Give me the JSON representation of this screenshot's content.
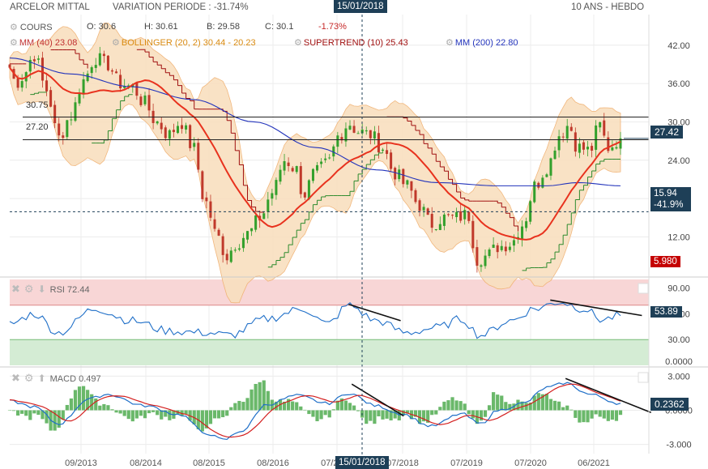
{
  "header": {
    "instrument": "ARCELOR MITTAL",
    "variation": "VARIATION PERIODE : -31.74%",
    "cursor_date": "15/01/2018",
    "period": "10 ANS - HEBDO"
  },
  "price_legend": {
    "cours": "COURS",
    "open": "O: 30.6",
    "high": "H: 30.61",
    "low": "B: 29.58",
    "close": "C: 30.1",
    "change": "-1.73%",
    "mm40": "MM (40)",
    "mm40_value": "23.08",
    "bollinger": "BOLLINGER (20, 2)",
    "bollinger_value": "30.44 - 20.23",
    "supertrend": "SUPERTREND (10)",
    "supertrend_value": "25.43",
    "mm200": "MM (200)",
    "mm200_value": "22.80"
  },
  "rsi_legend": {
    "name": "RSI",
    "value": "72.44"
  },
  "macd_legend": {
    "name": "MACD",
    "value": "0.497"
  },
  "colors": {
    "candle_up": "#33a02c",
    "candle_down": "#c0392b",
    "mm40": "#e8321e",
    "bollinger_fill": "#f9dfbf",
    "bollinger_line": "#f0b070",
    "supertrend_up": "#2e8b2e",
    "supertrend_down": "#a01010",
    "mm200": "#2233bb",
    "rsi_line": "#1f6fc8",
    "rsi_high_zone": "#f8d6d6",
    "rsi_low_zone": "#d4ecd4",
    "macd_line": "#1f6fc8",
    "macd_signal": "#d42020",
    "macd_hist": "#6ab86a",
    "current_box": "#1e3f57",
    "low_box": "#c40000"
  },
  "chart_data": [
    {
      "type": "candlestick",
      "title": "ARCELOR MITTAL",
      "ylim": [
        5.98,
        44
      ],
      "y_ticks": [
        "42.00",
        "36.00",
        "30.00",
        "24.00",
        "18.00",
        "12.00"
      ],
      "x_ticks": [
        "09/2013",
        "08/2014",
        "08/2015",
        "08/2016",
        "07/2017",
        "07/2018",
        "07/2019",
        "07/2020",
        "06/2021"
      ],
      "last_price": "27.42",
      "reference_line": "15.94",
      "reference_change": "-41.9%",
      "low_marker": "5.980",
      "horizontal_levels": [
        {
          "label": "30.75",
          "value": 30.75
        },
        {
          "label": "27.20",
          "value": 27.2
        }
      ],
      "close_anchors": [
        {
          "x": 0.0,
          "y": 38.5
        },
        {
          "x": 0.01,
          "y": 36.0
        },
        {
          "x": 0.02,
          "y": 37.0
        },
        {
          "x": 0.04,
          "y": 40.5
        },
        {
          "x": 0.06,
          "y": 35.0
        },
        {
          "x": 0.08,
          "y": 27.5
        },
        {
          "x": 0.1,
          "y": 31.0
        },
        {
          "x": 0.12,
          "y": 36.5
        },
        {
          "x": 0.14,
          "y": 40.0
        },
        {
          "x": 0.16,
          "y": 39.0
        },
        {
          "x": 0.18,
          "y": 36.0
        },
        {
          "x": 0.2,
          "y": 35.5
        },
        {
          "x": 0.22,
          "y": 33.0
        },
        {
          "x": 0.24,
          "y": 30.0
        },
        {
          "x": 0.26,
          "y": 28.0
        },
        {
          "x": 0.28,
          "y": 30.0
        },
        {
          "x": 0.3,
          "y": 26.0
        },
        {
          "x": 0.32,
          "y": 17.5
        },
        {
          "x": 0.34,
          "y": 12.0
        },
        {
          "x": 0.355,
          "y": 9.0
        },
        {
          "x": 0.37,
          "y": 11.0
        },
        {
          "x": 0.39,
          "y": 12.5
        },
        {
          "x": 0.41,
          "y": 15.0
        },
        {
          "x": 0.43,
          "y": 19.0
        },
        {
          "x": 0.45,
          "y": 24.0
        },
        {
          "x": 0.47,
          "y": 22.5
        },
        {
          "x": 0.48,
          "y": 18.5
        },
        {
          "x": 0.5,
          "y": 22.0
        },
        {
          "x": 0.52,
          "y": 23.5
        },
        {
          "x": 0.54,
          "y": 28.0
        },
        {
          "x": 0.555,
          "y": 29.8
        },
        {
          "x": 0.57,
          "y": 28.5
        },
        {
          "x": 0.59,
          "y": 28.0
        },
        {
          "x": 0.61,
          "y": 26.0
        },
        {
          "x": 0.63,
          "y": 22.0
        },
        {
          "x": 0.65,
          "y": 20.0
        },
        {
          "x": 0.67,
          "y": 17.0
        },
        {
          "x": 0.69,
          "y": 14.0
        },
        {
          "x": 0.71,
          "y": 15.0
        },
        {
          "x": 0.73,
          "y": 15.0
        },
        {
          "x": 0.75,
          "y": 15.5
        },
        {
          "x": 0.765,
          "y": 8.5
        },
        {
          "x": 0.78,
          "y": 9.0
        },
        {
          "x": 0.8,
          "y": 10.5
        },
        {
          "x": 0.82,
          "y": 11.0
        },
        {
          "x": 0.84,
          "y": 14.0
        },
        {
          "x": 0.86,
          "y": 20.0
        },
        {
          "x": 0.88,
          "y": 23.0
        },
        {
          "x": 0.9,
          "y": 28.0
        },
        {
          "x": 0.915,
          "y": 29.5
        },
        {
          "x": 0.93,
          "y": 26.0
        },
        {
          "x": 0.95,
          "y": 25.5
        },
        {
          "x": 0.965,
          "y": 29.5
        },
        {
          "x": 0.98,
          "y": 26.0
        },
        {
          "x": 1.0,
          "y": 27.42
        }
      ],
      "mm200_anchors": [
        {
          "x": 0.0,
          "y": 40.0
        },
        {
          "x": 0.1,
          "y": 37.5
        },
        {
          "x": 0.2,
          "y": 35.5
        },
        {
          "x": 0.3,
          "y": 33.5
        },
        {
          "x": 0.4,
          "y": 30.0
        },
        {
          "x": 0.5,
          "y": 26.0
        },
        {
          "x": 0.6,
          "y": 22.5
        },
        {
          "x": 0.7,
          "y": 20.5
        },
        {
          "x": 0.8,
          "y": 20.0
        },
        {
          "x": 0.88,
          "y": 20.0
        },
        {
          "x": 0.93,
          "y": 20.5
        },
        {
          "x": 1.0,
          "y": 20.0
        }
      ]
    },
    {
      "type": "line",
      "title": "RSI",
      "ylim": [
        0,
        100
      ],
      "y_ticks": [
        "90.00",
        "60.00",
        "30.00",
        "0.0000"
      ],
      "last_value": "53.89",
      "overbought": 70,
      "oversold": 30,
      "anchors": [
        {
          "x": 0.0,
          "y": 48
        },
        {
          "x": 0.04,
          "y": 60
        },
        {
          "x": 0.08,
          "y": 38
        },
        {
          "x": 0.14,
          "y": 66
        },
        {
          "x": 0.2,
          "y": 52
        },
        {
          "x": 0.26,
          "y": 40
        },
        {
          "x": 0.32,
          "y": 38
        },
        {
          "x": 0.36,
          "y": 35
        },
        {
          "x": 0.42,
          "y": 54
        },
        {
          "x": 0.48,
          "y": 66
        },
        {
          "x": 0.52,
          "y": 48
        },
        {
          "x": 0.555,
          "y": 70
        },
        {
          "x": 0.6,
          "y": 52
        },
        {
          "x": 0.65,
          "y": 38
        },
        {
          "x": 0.7,
          "y": 44
        },
        {
          "x": 0.74,
          "y": 54
        },
        {
          "x": 0.77,
          "y": 35
        },
        {
          "x": 0.82,
          "y": 52
        },
        {
          "x": 0.86,
          "y": 66
        },
        {
          "x": 0.9,
          "y": 74
        },
        {
          "x": 0.94,
          "y": 66
        },
        {
          "x": 0.97,
          "y": 53
        },
        {
          "x": 1.0,
          "y": 58
        }
      ],
      "trendlines": [
        {
          "x1": 0.555,
          "y1": 71,
          "x2": 0.64,
          "y2": 52
        },
        {
          "x1": 0.885,
          "y1": 76,
          "x2": 1.035,
          "y2": 58
        }
      ]
    },
    {
      "type": "line",
      "title": "MACD",
      "ylim": [
        -3.6,
        3.6
      ],
      "y_ticks": [
        "3.000",
        "0.0000",
        "-3.000"
      ],
      "last_value": "0.2362",
      "anchors": [
        {
          "x": 0.0,
          "y": 0.8
        },
        {
          "x": 0.04,
          "y": 0.3
        },
        {
          "x": 0.08,
          "y": -1.2
        },
        {
          "x": 0.13,
          "y": 1.0
        },
        {
          "x": 0.16,
          "y": 1.4
        },
        {
          "x": 0.22,
          "y": 0.4
        },
        {
          "x": 0.28,
          "y": -0.4
        },
        {
          "x": 0.32,
          "y": -2.0
        },
        {
          "x": 0.35,
          "y": -2.6
        },
        {
          "x": 0.38,
          "y": -1.8
        },
        {
          "x": 0.42,
          "y": 0.5
        },
        {
          "x": 0.47,
          "y": 1.3
        },
        {
          "x": 0.52,
          "y": 0.6
        },
        {
          "x": 0.555,
          "y": 1.5
        },
        {
          "x": 0.6,
          "y": 0.4
        },
        {
          "x": 0.64,
          "y": -0.3
        },
        {
          "x": 0.69,
          "y": -1.4
        },
        {
          "x": 0.74,
          "y": -0.3
        },
        {
          "x": 0.77,
          "y": -1.2
        },
        {
          "x": 0.8,
          "y": 0.0
        },
        {
          "x": 0.84,
          "y": 0.6
        },
        {
          "x": 0.88,
          "y": 2.0
        },
        {
          "x": 0.91,
          "y": 2.4
        },
        {
          "x": 0.95,
          "y": 1.4
        },
        {
          "x": 1.0,
          "y": 0.6
        }
      ],
      "trendlines": [
        {
          "x1": 0.56,
          "y1": 2.3,
          "x2": 0.645,
          "y2": -0.5
        },
        {
          "x1": 0.91,
          "y1": 2.8,
          "x2": 1.05,
          "y2": -0.2
        }
      ]
    }
  ]
}
